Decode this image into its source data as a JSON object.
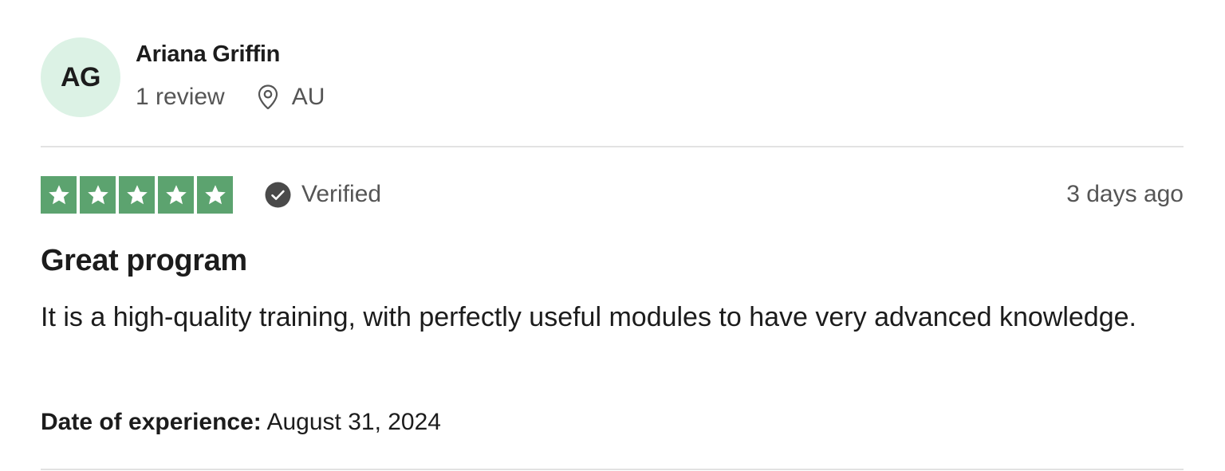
{
  "consumer": {
    "initials": "AG",
    "name": "Ariana Griffin",
    "review_count": "1 review",
    "location": "AU",
    "location_icon": "location-pin-icon",
    "avatar_color": "#dcf2e5"
  },
  "rating": {
    "stars": 5,
    "max_stars": 5,
    "star_color": "#5ca36f",
    "star_icon": "star-icon",
    "verified_label": "Verified",
    "verified_icon": "check-circle-icon",
    "date": "3 days ago"
  },
  "review": {
    "title": "Great program",
    "text": "It is a high-quality training, with perfectly useful modules to have very advanced knowledge.",
    "experience_label": "Date of experience:",
    "experience_date": "August 31, 2024"
  }
}
